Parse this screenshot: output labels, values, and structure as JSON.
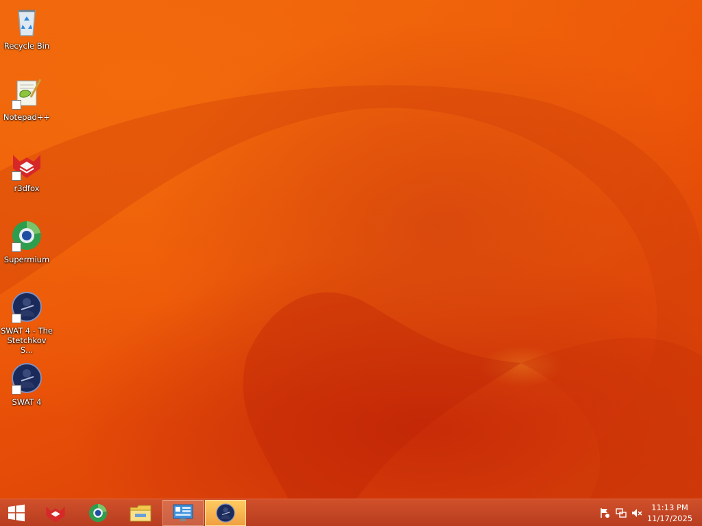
{
  "desktop": {
    "icons": [
      {
        "label": "Recycle Bin",
        "icon": "recycle-bin-icon"
      },
      {
        "label": "Notepad++",
        "icon": "notepadpp-icon"
      },
      {
        "label": "r3dfox",
        "icon": "r3dfox-icon"
      },
      {
        "label": "Supermium",
        "icon": "supermium-icon"
      },
      {
        "label": "SWAT 4 - The Stetchkov S...",
        "icon": "swat4-expansion-icon"
      },
      {
        "label": "SWAT 4",
        "icon": "swat4-icon"
      }
    ]
  },
  "taskbar": {
    "start": "windows-start-icon",
    "pinned": [
      {
        "icon": "r3dfox-icon"
      },
      {
        "icon": "supermium-icon"
      },
      {
        "icon": "file-explorer-icon"
      },
      {
        "icon": "control-panel-icon",
        "state": "active"
      },
      {
        "icon": "swat4-icon",
        "state": "focused"
      }
    ],
    "tray": [
      "action-center-flag-icon",
      "network-icon",
      "volume-muted-icon"
    ],
    "clock": {
      "time": "11:13 PM",
      "date": "11/17/2025"
    }
  },
  "colors": {
    "wallpaper_base": "#ec5508",
    "taskbar": "#c4462a",
    "focused_button": "#f5b04a"
  }
}
